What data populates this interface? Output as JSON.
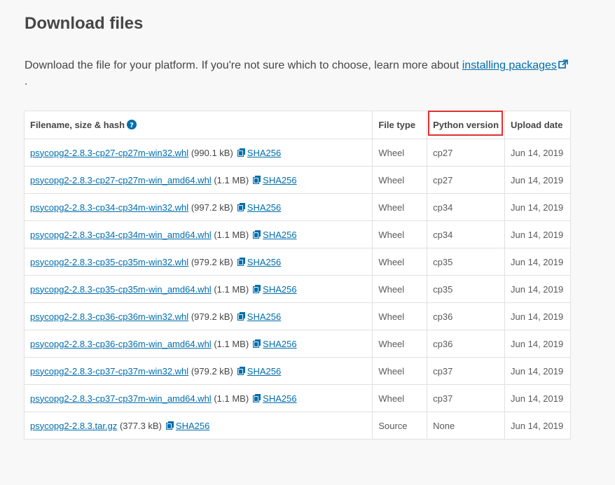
{
  "heading": "Download files",
  "intro": {
    "text": "Download the file for your platform. If you're not sure which to choose, learn more about ",
    "link_label": "installing packages",
    "suffix": "."
  },
  "table": {
    "headers": {
      "filename": "Filename, size & hash",
      "filetype": "File type",
      "pyversion": "Python version",
      "uploaded": "Upload date"
    },
    "rows": [
      {
        "filename": "psycopg2-2.8.3-cp27-cp27m-win32.whl",
        "size": "(990.1 kB)",
        "hash": "SHA256",
        "type": "Wheel",
        "python": "cp27",
        "date": "Jun 14, 2019"
      },
      {
        "filename": "psycopg2-2.8.3-cp27-cp27m-win_amd64.whl",
        "size": "(1.1 MB)",
        "hash": "SHA256",
        "type": "Wheel",
        "python": "cp27",
        "date": "Jun 14, 2019"
      },
      {
        "filename": "psycopg2-2.8.3-cp34-cp34m-win32.whl",
        "size": "(997.2 kB)",
        "hash": "SHA256",
        "type": "Wheel",
        "python": "cp34",
        "date": "Jun 14, 2019"
      },
      {
        "filename": "psycopg2-2.8.3-cp34-cp34m-win_amd64.whl",
        "size": "(1.1 MB)",
        "hash": "SHA256",
        "type": "Wheel",
        "python": "cp34",
        "date": "Jun 14, 2019"
      },
      {
        "filename": "psycopg2-2.8.3-cp35-cp35m-win32.whl",
        "size": "(979.2 kB)",
        "hash": "SHA256",
        "type": "Wheel",
        "python": "cp35",
        "date": "Jun 14, 2019"
      },
      {
        "filename": "psycopg2-2.8.3-cp35-cp35m-win_amd64.whl",
        "size": "(1.1 MB)",
        "hash": "SHA256",
        "type": "Wheel",
        "python": "cp35",
        "date": "Jun 14, 2019"
      },
      {
        "filename": "psycopg2-2.8.3-cp36-cp36m-win32.whl",
        "size": "(979.2 kB)",
        "hash": "SHA256",
        "type": "Wheel",
        "python": "cp36",
        "date": "Jun 14, 2019"
      },
      {
        "filename": "psycopg2-2.8.3-cp36-cp36m-win_amd64.whl",
        "size": "(1.1 MB)",
        "hash": "SHA256",
        "type": "Wheel",
        "python": "cp36",
        "date": "Jun 14, 2019"
      },
      {
        "filename": "psycopg2-2.8.3-cp37-cp37m-win32.whl",
        "size": "(979.2 kB)",
        "hash": "SHA256",
        "type": "Wheel",
        "python": "cp37",
        "date": "Jun 14, 2019"
      },
      {
        "filename": "psycopg2-2.8.3-cp37-cp37m-win_amd64.whl",
        "size": "(1.1 MB)",
        "hash": "SHA256",
        "type": "Wheel",
        "python": "cp37",
        "date": "Jun 14, 2019"
      },
      {
        "filename": "psycopg2-2.8.3.tar.gz",
        "size": "(377.3 kB)",
        "hash": "SHA256",
        "type": "Source",
        "python": "None",
        "date": "Jun 14, 2019"
      }
    ]
  },
  "icons": {
    "help": "question-circle-icon",
    "external": "external-link-icon",
    "hash": "copy-icon"
  },
  "colors": {
    "link": "#006dad",
    "highlight_box": "#e0302f"
  }
}
